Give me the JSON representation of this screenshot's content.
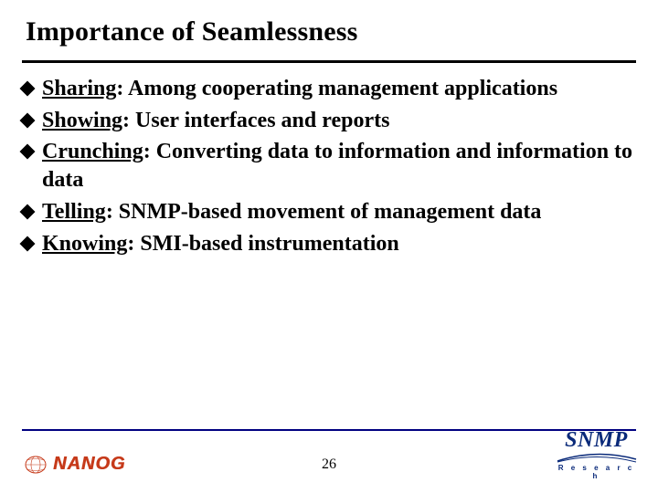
{
  "title": "Importance of Seamlessness",
  "bullets": [
    {
      "term": "Sharing",
      "text": ":  Among cooperating management applications"
    },
    {
      "term": "Showing",
      "text": ":  User interfaces and reports"
    },
    {
      "term": "Crunching",
      "text": ":  Converting data to information and information to data"
    },
    {
      "term": "Telling",
      "text": ":  SNMP-based movement of management data"
    },
    {
      "term": "Knowing",
      "text": ":  SMI-based instrumentation"
    }
  ],
  "pageNumber": "26",
  "logos": {
    "left": {
      "text": "NANOG"
    },
    "right": {
      "main": "SNMP",
      "sub": "R e s e a r c h"
    }
  }
}
